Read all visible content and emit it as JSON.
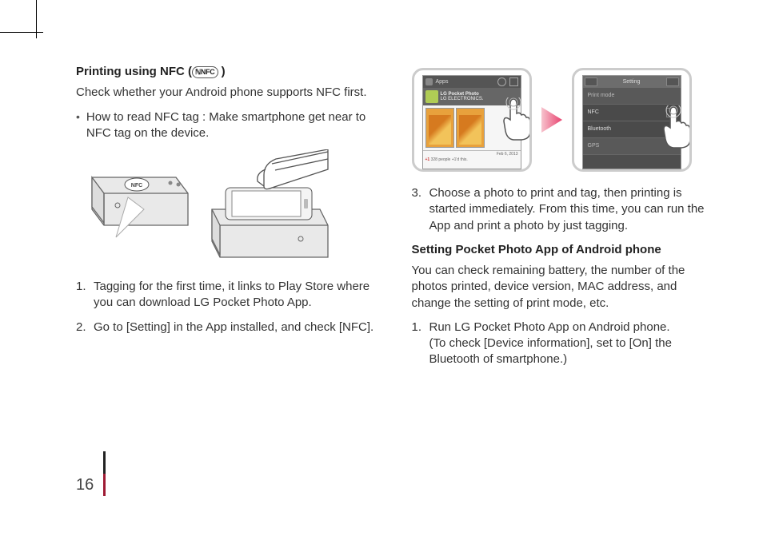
{
  "left": {
    "heading_prefix": "Printing using NFC (",
    "heading_icon_text": "NFC",
    "heading_suffix": " )",
    "intro": "Check whether your Android phone supports NFC first.",
    "bullet": "How to read NFC tag : Make smartphone get near to NFC tag on the device.",
    "device_label": "NFC",
    "steps": [
      "Tagging for the first time, it links to Play Store where you can download LG Pocket Photo App.",
      "Go to [Setting] in the App installed, and check [NFC]."
    ]
  },
  "phones": {
    "apps_label": "Apps",
    "app_title": "LG Pocket Photo",
    "app_sub": "LG ELECTRONICS.",
    "footer_date": "Feb 6, 2013",
    "footer_people": "328 people +1'd this.",
    "right_title": "Setting",
    "rows": [
      "Print mode",
      "NFC",
      "Bluetooth",
      "GPS"
    ]
  },
  "right": {
    "step3": "Choose a photo to print and tag, then printing is started immediately. From this time, you can run the App and print a photo by just tagging.",
    "heading2": "Setting Pocket Photo App of Android phone",
    "para2": "You can check remaining battery, the number of the photos printed, device version, MAC address, and change the setting of print mode, etc.",
    "step1b_line1": "Run LG Pocket Photo App on Android phone.",
    "step1b_line2": "(To check [Device information], set to [On] the Bluetooth of smartphone.)"
  },
  "page_number": "16"
}
